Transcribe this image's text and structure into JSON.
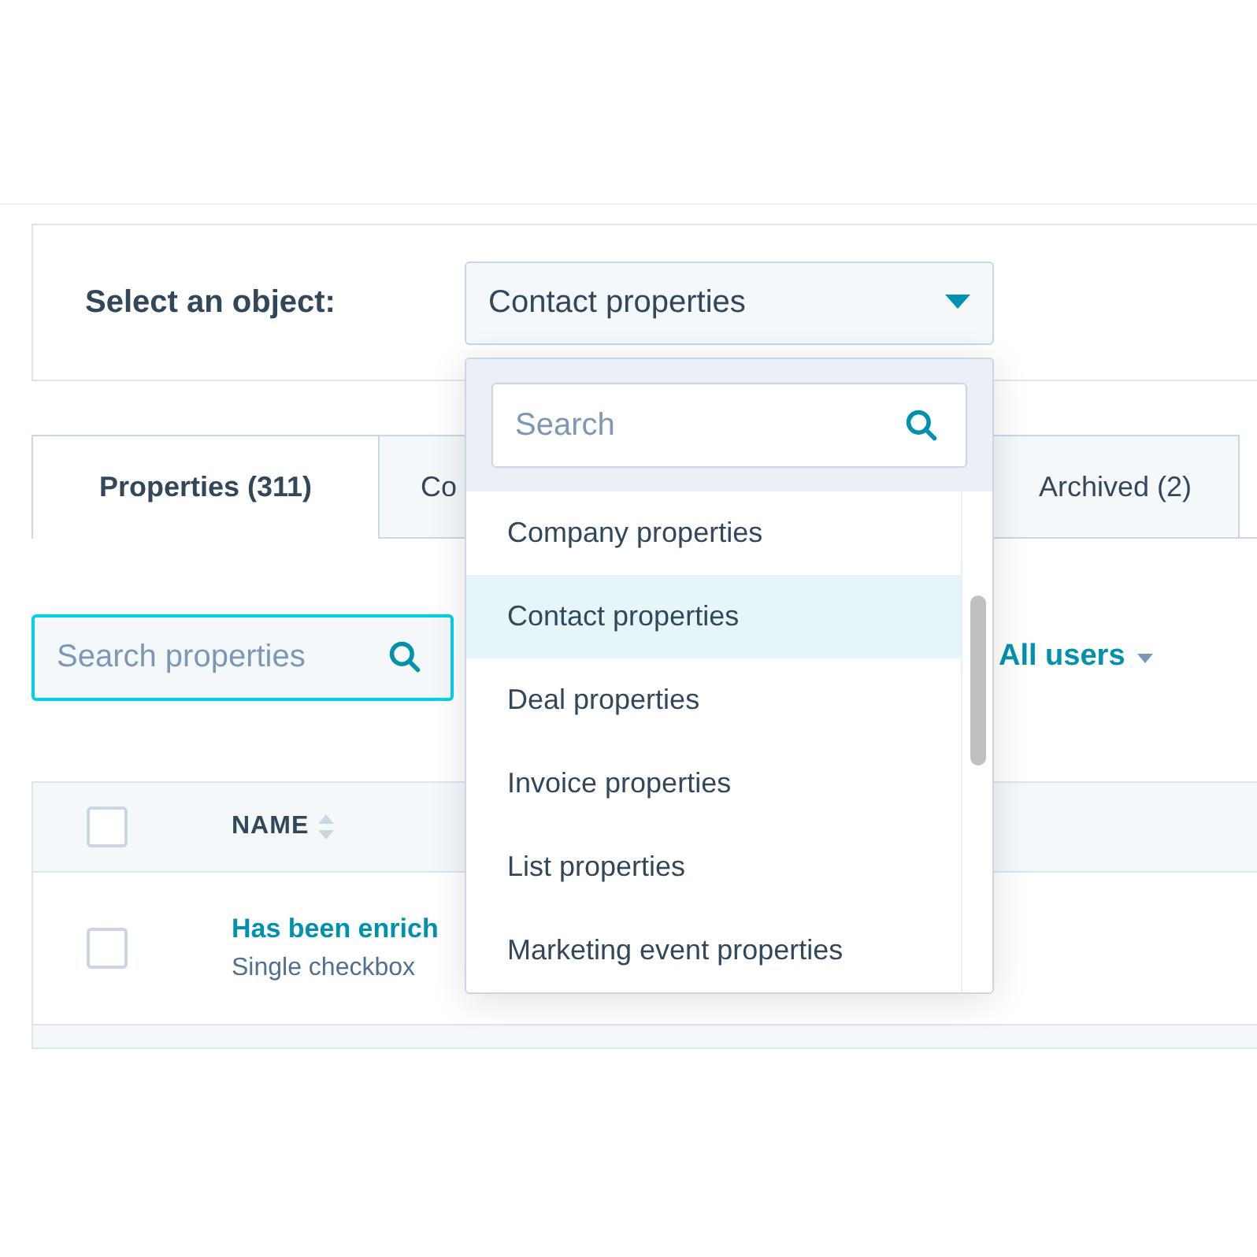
{
  "object_selector": {
    "label": "Select an object:",
    "value": "Contact properties",
    "expanded": true
  },
  "dropdown": {
    "search": {
      "placeholder": "Search"
    },
    "options": [
      {
        "label": "Company properties",
        "selected": false
      },
      {
        "label": "Contact properties",
        "selected": true
      },
      {
        "label": "Deal properties",
        "selected": false
      },
      {
        "label": "Invoice properties",
        "selected": false
      },
      {
        "label": "List properties",
        "selected": false
      },
      {
        "label": "Marketing event properties",
        "selected": false
      }
    ]
  },
  "tabs": [
    {
      "label": "Properties (311)",
      "selected": true
    },
    {
      "label": "Co",
      "selected": false
    },
    {
      "label": "Archived (2)",
      "selected": false
    }
  ],
  "property_search": {
    "placeholder": "Search properties"
  },
  "filter": {
    "label": "All users"
  },
  "table": {
    "select_all_checked": false,
    "columns": [
      "NAME"
    ],
    "rows": [
      {
        "checked": false,
        "name": "Has been enrich",
        "type": "Single checkbox"
      }
    ]
  }
}
